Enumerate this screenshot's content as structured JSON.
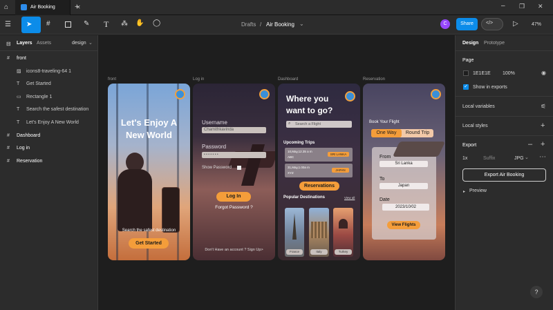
{
  "titlebar": {
    "tab_title": "Air Booking",
    "add_tab": "+"
  },
  "toolbar": {
    "breadcrumb_drafts": "Drafts",
    "breadcrumb_sep": "/",
    "file_name": "Air Booking",
    "avatar_initial": "C",
    "share_label": "Share",
    "zoom": "47%"
  },
  "leftpanel": {
    "tabs": {
      "layers": "Layers",
      "assets": "Assets",
      "page": "design"
    },
    "layers": [
      {
        "label": "front",
        "kind": "frame"
      },
      {
        "label": "icons8-traveling-64 1",
        "kind": "image"
      },
      {
        "label": "Get Started",
        "kind": "text"
      },
      {
        "label": "Rectangle 1",
        "kind": "rect"
      },
      {
        "label": "Search the safest destination",
        "kind": "text"
      },
      {
        "label": "Let's Enjoy A New World",
        "kind": "text"
      },
      {
        "label": "Dashboard",
        "kind": "frame"
      },
      {
        "label": "Log in",
        "kind": "frame"
      },
      {
        "label": "Reservation",
        "kind": "frame"
      }
    ]
  },
  "rightpanel": {
    "tabs": {
      "design": "Design",
      "prototype": "Prototype"
    },
    "page_title": "Page",
    "page_color": "1E1E1E",
    "page_opacity": "100%",
    "show_exports": "Show in exports",
    "local_variables": "Local variables",
    "local_styles": "Local styles",
    "export_title": "Export",
    "export_scale": "1x",
    "export_suffix": "Suffix",
    "export_format": "JPG",
    "export_button": "Export Air Booking",
    "preview": "Preview",
    "help": "?"
  },
  "frames": {
    "front": {
      "label": "front",
      "heading": "Let's Enjoy A New World",
      "subtitle": "Search the safest destination",
      "button": "Get Started"
    },
    "login": {
      "label": "Log in",
      "username_label": "Username",
      "username_value": "Chamithkavinda",
      "password_label": "Password",
      "password_value": "• • • • • • •",
      "show_password": "Show Password",
      "login_button": "Log In",
      "forgot": "Forgot Password ?",
      "signup": "Don't Have an account ? Sign Up>"
    },
    "dashboard": {
      "label": "Dashboard",
      "heading": "Where you want to go?",
      "search_placeholder": "Search a Flight",
      "upcoming": "Upcoming Trips",
      "trips": [
        {
          "date": "10,May,12.35 a m",
          "code": "ABC",
          "dest": "SRI LANKA"
        },
        {
          "date": "31,May,1.00a m",
          "code": "XYZ",
          "dest": "JAPAN"
        }
      ],
      "reservations_button": "Reservations",
      "popular": "Popular Destinations",
      "view_all": "View all",
      "destinations": [
        {
          "name": "France"
        },
        {
          "name": "Italy"
        },
        {
          "name": "Turkey"
        }
      ]
    },
    "reservation": {
      "label": "Reservation",
      "heading": "Book Your Flight",
      "one_way": "One Way",
      "round_trip": "Round Trip",
      "from_label": "From",
      "from_value": "Sri Lanka",
      "to_label": "To",
      "to_value": "Japan",
      "date_label": "Date",
      "date_value": "2023/10/02",
      "view_button": "View Flights"
    }
  }
}
